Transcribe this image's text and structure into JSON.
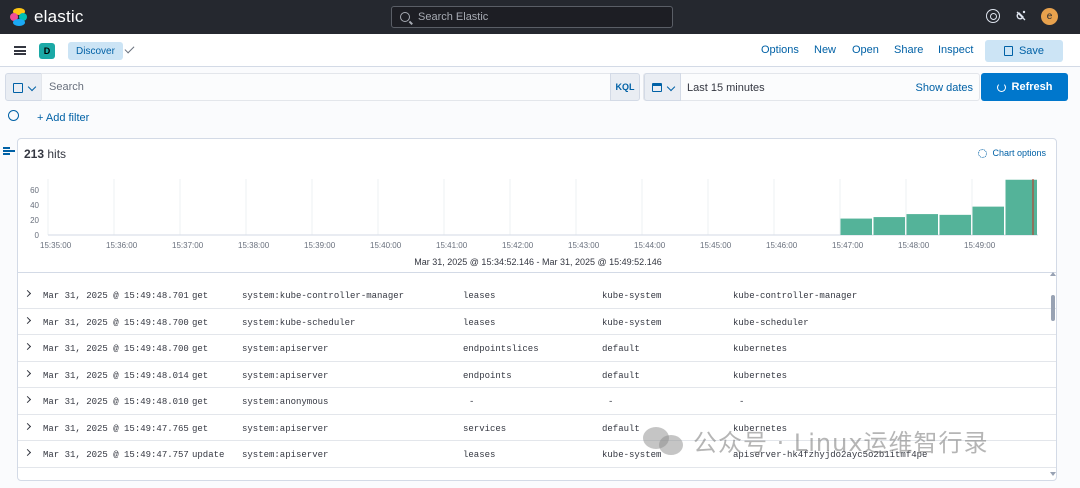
{
  "topbar": {
    "brand": "elastic",
    "search_placeholder": "Search Elastic",
    "user_initial": "e"
  },
  "appbar": {
    "space_initial": "D",
    "breadcrumb": "Discover",
    "menu": [
      "Options",
      "New",
      "Open",
      "Share",
      "Inspect"
    ],
    "save_label": "Save"
  },
  "query": {
    "placeholder": "Search",
    "language": "KQL",
    "time_range": "Last 15 minutes",
    "show_dates": "Show dates",
    "refresh_label": "Refresh"
  },
  "filters": {
    "add_filter": "+ Add filter"
  },
  "results": {
    "hit_count": "213",
    "hits_label": "hits",
    "chart_options": "Chart options",
    "range": "Mar 31, 2025 @ 15:34:52.146 - Mar 31, 2025 @ 15:49:52.146"
  },
  "chart_data": {
    "type": "bar",
    "categories": [
      "15:47:00",
      "15:47:30",
      "15:48:00",
      "15:48:30",
      "15:49:00",
      "15:49:30"
    ],
    "values": [
      22,
      24,
      28,
      27,
      38,
      74
    ],
    "ylim": [
      0,
      75
    ],
    "yticks": [
      0,
      20,
      40,
      60
    ],
    "xticks": [
      "15:35:00",
      "15:36:00",
      "15:37:00",
      "15:38:00",
      "15:39:00",
      "15:40:00",
      "15:41:00",
      "15:42:00",
      "15:43:00",
      "15:44:00",
      "15:45:00",
      "15:46:00",
      "15:47:00",
      "15:48:00",
      "15:49:00"
    ],
    "color": "#54b399",
    "grid": true
  },
  "documents": [
    {
      "time": "Mar 31, 2025 @ 15:49:48.701",
      "verb": "get",
      "user": "system:kube-controller-manager",
      "resource": "leases",
      "namespace": "kube-system",
      "name": "kube-controller-manager"
    },
    {
      "time": "Mar 31, 2025 @ 15:49:48.700",
      "verb": "get",
      "user": "system:kube-scheduler",
      "resource": "leases",
      "namespace": "kube-system",
      "name": "kube-scheduler"
    },
    {
      "time": "Mar 31, 2025 @ 15:49:48.700",
      "verb": "get",
      "user": "system:apiserver",
      "resource": "endpointslices",
      "namespace": "default",
      "name": "kubernetes"
    },
    {
      "time": "Mar 31, 2025 @ 15:49:48.014",
      "verb": "get",
      "user": "system:apiserver",
      "resource": "endpoints",
      "namespace": "default",
      "name": "kubernetes"
    },
    {
      "time": "Mar 31, 2025 @ 15:49:48.010",
      "verb": "get",
      "user": "system:anonymous",
      "resource": "-",
      "namespace": "-",
      "name": "-"
    },
    {
      "time": "Mar 31, 2025 @ 15:49:47.765",
      "verb": "get",
      "user": "system:apiserver",
      "resource": "services",
      "namespace": "default",
      "name": "kubernetes"
    },
    {
      "time": "Mar 31, 2025 @ 15:49:47.757",
      "verb": "update",
      "user": "system:apiserver",
      "resource": "leases",
      "namespace": "kube-system",
      "name": "apiserver-hk4fzhyjdo2ayc5o2b1itmf4pe"
    }
  ],
  "watermark": "公众号 · Linux运维智行录"
}
